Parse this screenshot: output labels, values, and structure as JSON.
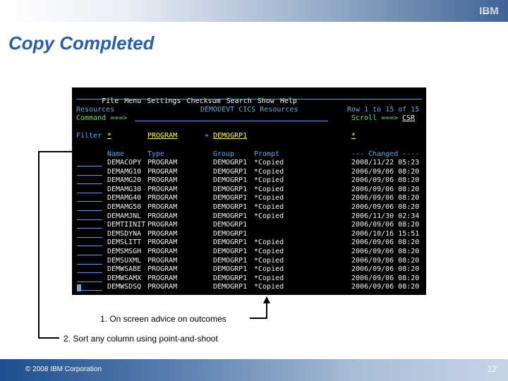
{
  "slide": {
    "title": "Copy Completed",
    "logo_text": "IBM",
    "copyright": "© 2008 IBM Corporation",
    "page_number": "12"
  },
  "terminal": {
    "menu": [
      "File",
      "Menu",
      "Settings",
      "Checksum",
      "Search",
      "Show",
      "Help"
    ],
    "panel_name": "Resources",
    "panel_title": "DEMODEVT CICS Resources",
    "row_info": "Row 1 to 15 of 15",
    "command_label": "Command ===>",
    "scroll_label": "Scroll ===>",
    "scroll_value": "CSR",
    "filter_label": "Filter",
    "filter_name": "*",
    "filter_type": "PROGRAM",
    "filter_plus": "+",
    "filter_group": "DEMOGRP1",
    "filter_changed": "*",
    "headers": {
      "name": "Name",
      "type": "Type",
      "group": "Group",
      "prompt": "Prompt",
      "changed": "--- Changed ----"
    },
    "rows": [
      {
        "name": "DEMACOPY",
        "type": "PROGRAM",
        "group": "DEMOGRP1",
        "prompt": "*Copied",
        "changed": "2008/11/22 05:23"
      },
      {
        "name": "DEMAMG10",
        "type": "PROGRAM",
        "group": "DEMOGRP1",
        "prompt": "*Copied",
        "changed": "2006/09/06 08:20"
      },
      {
        "name": "DEMAMG20",
        "type": "PROGRAM",
        "group": "DEMOGRP1",
        "prompt": "*Copied",
        "changed": "2006/09/06 08:20"
      },
      {
        "name": "DEMAMG30",
        "type": "PROGRAM",
        "group": "DEMOGRP1",
        "prompt": "*Copied",
        "changed": "2006/09/06 08:20"
      },
      {
        "name": "DEMAMG40",
        "type": "PROGRAM",
        "group": "DEMOGRP1",
        "prompt": "*Copied",
        "changed": "2006/09/06 08:20"
      },
      {
        "name": "DEMAMG50",
        "type": "PROGRAM",
        "group": "DEMOGRP1",
        "prompt": "*Copied",
        "changed": "2006/09/06 08:20"
      },
      {
        "name": "DEMAMJNL",
        "type": "PROGRAM",
        "group": "DEMOGRP1",
        "prompt": "*Copied",
        "changed": "2006/11/30 02:34"
      },
      {
        "name": "DEMTIINIT",
        "type": "PROGRAM",
        "group": "DEMOGRP1",
        "prompt": "",
        "changed": "2006/09/06 08:20"
      },
      {
        "name": "DEMSDYNA",
        "type": "PROGRAM",
        "group": "DEMOGRP1",
        "prompt": "",
        "changed": "2006/10/16 15:51"
      },
      {
        "name": "DEMSLITT",
        "type": "PROGRAM",
        "group": "DEMOGRP1",
        "prompt": "*Copied",
        "changed": "2006/09/06 08:20"
      },
      {
        "name": "DEMSMSGH",
        "type": "PROGRAM",
        "group": "DEMOGRP1",
        "prompt": "*Copied",
        "changed": "2006/09/06 08:20"
      },
      {
        "name": "DEMSUXML",
        "type": "PROGRAM",
        "group": "DEMOGRP1",
        "prompt": "*Copied",
        "changed": "2006/09/06 08:20"
      },
      {
        "name": "DEMWSABE",
        "type": "PROGRAM",
        "group": "DEMOGRP1",
        "prompt": "*Copied",
        "changed": "2006/09/06 08:20"
      },
      {
        "name": "DEMWSAMX",
        "type": "PROGRAM",
        "group": "DEMOGRP1",
        "prompt": "*Copied",
        "changed": "2006/09/06 08:20"
      },
      {
        "name": "DEMWSDSQ",
        "type": "PROGRAM",
        "group": "DEMOGRP1",
        "prompt": "*Copied",
        "changed": "2006/09/06 08:20"
      }
    ]
  },
  "callouts": {
    "one": "1.  On screen advice on outcomes",
    "two": "2.  Sort any column using point-and-shoot"
  },
  "colors": {
    "title": "#2a5ea8",
    "terminal_bg": "#000000",
    "terminal_text": "#7fb0f0",
    "highlight": "#ffff55"
  }
}
